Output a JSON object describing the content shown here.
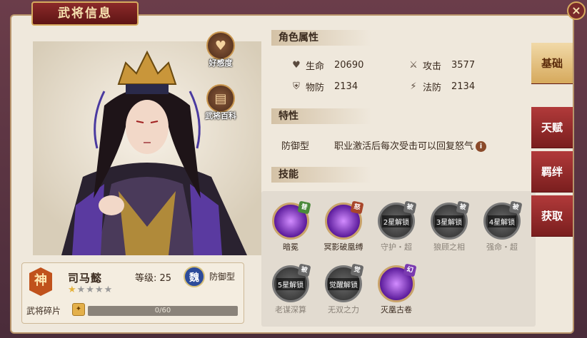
{
  "header": {
    "title": "武将信息",
    "close_label": "×"
  },
  "portrait_buttons": [
    {
      "label": "好感度",
      "icon": "heart-icon"
    },
    {
      "label": "武将百科",
      "icon": "book-icon"
    }
  ],
  "hero": {
    "faction_badge": "神",
    "name": "司马懿",
    "level_text": "等级: 25",
    "kingdom": "魏",
    "role": "防御型",
    "stars_filled": "★",
    "stars_empty": "★★★★",
    "star_count": 1,
    "max_stars": 5,
    "fragments_label": "武将碎片",
    "fragments_progress": "0/60",
    "fragments_current": 0,
    "fragments_total": 60
  },
  "attributes": {
    "heading": "角色属性",
    "stats": [
      {
        "label": "生命",
        "value": "20690",
        "icon": "heart-icon"
      },
      {
        "label": "攻击",
        "value": "3577",
        "icon": "sword-icon"
      },
      {
        "label": "物防",
        "value": "2134",
        "icon": "shield-icon"
      },
      {
        "label": "法防",
        "value": "2134",
        "icon": "magic-shield-icon"
      }
    ]
  },
  "trait": {
    "heading": "特性",
    "type": "防御型",
    "description": "职业激活后每次受击可以回复怒气",
    "info_icon": "i"
  },
  "skills": {
    "heading": "技能",
    "items": [
      {
        "name": "暗冕",
        "badge": "普",
        "overlay": "",
        "locked": false
      },
      {
        "name": "冥影破凰缚",
        "badge": "怒",
        "overlay": "",
        "locked": false
      },
      {
        "name": "守护・超",
        "badge": "被",
        "overlay": "2星解锁",
        "locked": true
      },
      {
        "name": "狼顾之相",
        "badge": "被",
        "overlay": "3星解锁",
        "locked": true
      },
      {
        "name": "强命・超",
        "badge": "被",
        "overlay": "4星解锁",
        "locked": true
      },
      {
        "name": "老谋深算",
        "badge": "被",
        "overlay": "5星解锁",
        "locked": true
      },
      {
        "name": "无双之力",
        "badge": "觉",
        "overlay": "觉醒解锁",
        "locked": true
      },
      {
        "name": "灭凰古卷",
        "badge": "幻",
        "overlay": "",
        "locked": false
      }
    ]
  },
  "tabs": [
    {
      "label": "基础",
      "active": true
    },
    {
      "label": "天赋",
      "active": false
    },
    {
      "label": "羁绊",
      "active": false
    },
    {
      "label": "获取",
      "active": false
    }
  ],
  "colors": {
    "accent": "#b13a3a",
    "gold": "#d6aa5e",
    "panel": "#efe8dc"
  }
}
